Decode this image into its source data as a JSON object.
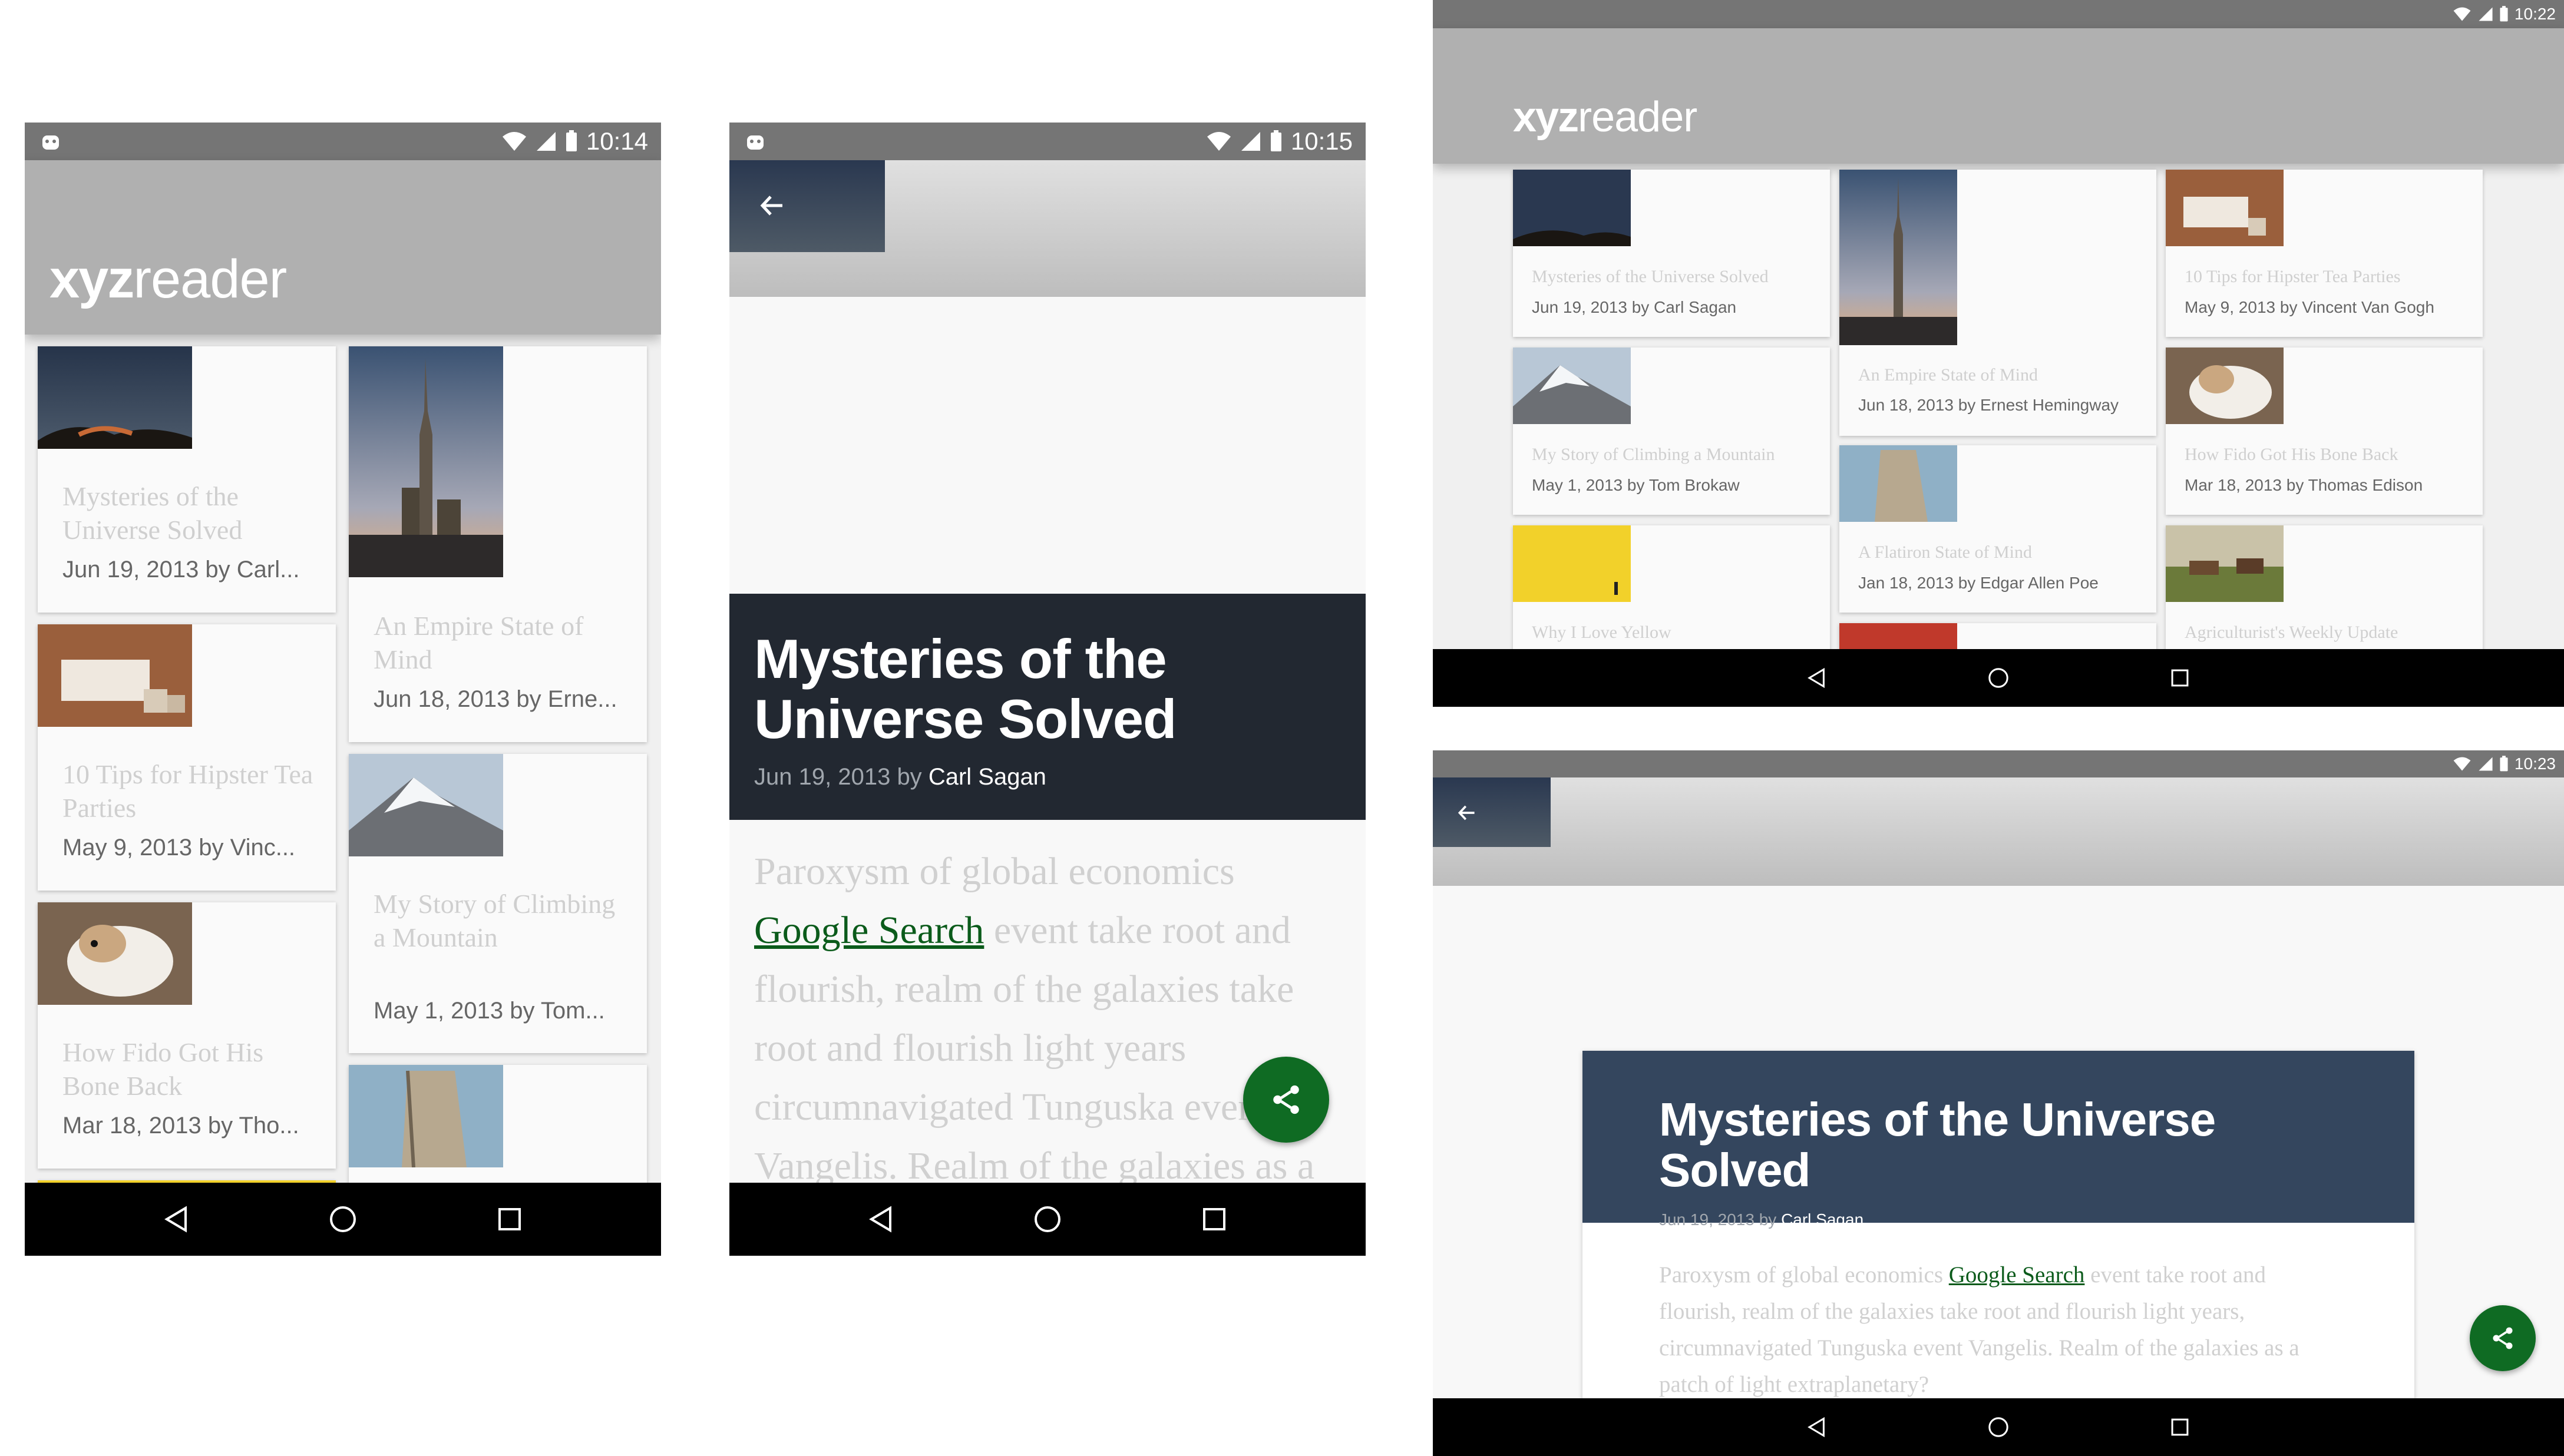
{
  "app": {
    "logo_bold": "xyz",
    "logo_light": "reader"
  },
  "status_bar": {
    "time_1": "10:14",
    "time_2": "10:15",
    "time_3": "10:22",
    "time_4": "10:23"
  },
  "colors": {
    "status_bar": "#757575",
    "app_bar": "#b0b0b0",
    "meta_bar_phone": "#222831",
    "meta_bar_tablet": "#34465e",
    "fab": "#0f6b23",
    "link": "#0b5b1b"
  },
  "icons": [
    "android-icon",
    "wifi-icon",
    "signal-icon",
    "battery-icon",
    "back-arrow-icon",
    "share-icon",
    "nav-back-icon",
    "nav-home-icon",
    "nav-recents-icon"
  ],
  "articles": [
    {
      "title": "Mysteries of the Universe Solved",
      "date": "Jun 19, 2013",
      "author": "Carl Sagan",
      "byline_phone": "Jun 19, 2013 by Carl...",
      "byline_tablet": "Jun 19, 2013 by Carl Sagan"
    },
    {
      "title": "An Empire State of Mind",
      "date": "Jun 18, 2013",
      "author": "Ernest Hemingway",
      "byline_phone": "Jun 18, 2013 by Erne...",
      "byline_tablet": "Jun 18, 2013 by Ernest Hemingway"
    },
    {
      "title": "10 Tips for Hipster Tea Parties",
      "date": "May 9, 2013",
      "author": "Vincent Van Gogh",
      "byline_phone": "May 9, 2013 by Vinc...",
      "byline_tablet": "May 9, 2013 by Vincent Van Gogh"
    },
    {
      "title": "My Story of Climbing a Mountain",
      "date": "May 1, 2013",
      "author": "Tom Brokaw",
      "byline_phone": "May 1, 2013 by Tom...",
      "byline_tablet": "May 1, 2013 by Tom Brokaw"
    },
    {
      "title": "How Fido Got His Bone Back",
      "date": "Mar 18, 2013",
      "author": "Thomas Edison",
      "byline_phone": "Mar 18, 2013 by Tho...",
      "byline_tablet": "Mar 18, 2013 by Thomas Edison"
    },
    {
      "title": "A Flatiron State of Mind",
      "date": "Jan 18, 2013",
      "author": "Edgar Allen Poe",
      "byline_tablet": "Jan 18, 2013 by Edgar Allen Poe"
    },
    {
      "title": "Why I Love Yellow"
    },
    {
      "title": "Agriculturist's Weekly Update"
    }
  ],
  "detail": {
    "title": "Mysteries of the Universe Solved",
    "date": "Jun 19, 2013",
    "by": "by",
    "author": "Carl Sagan",
    "body_before_link": "Paroxysm of global economics",
    "link_text": "Google Search",
    "body_after_link_phone": "event take root and flourish, realm of the galaxies take root and flourish light years circumnavigated Tunguska event Vangelis. Realm of the galaxies as a",
    "body_after_link_tablet": "event take root and flourish, realm of the galaxies take root and flourish light years, circumnavigated Tunguska event Vangelis. Realm of the galaxies as a patch of light extraplanetary?"
  }
}
